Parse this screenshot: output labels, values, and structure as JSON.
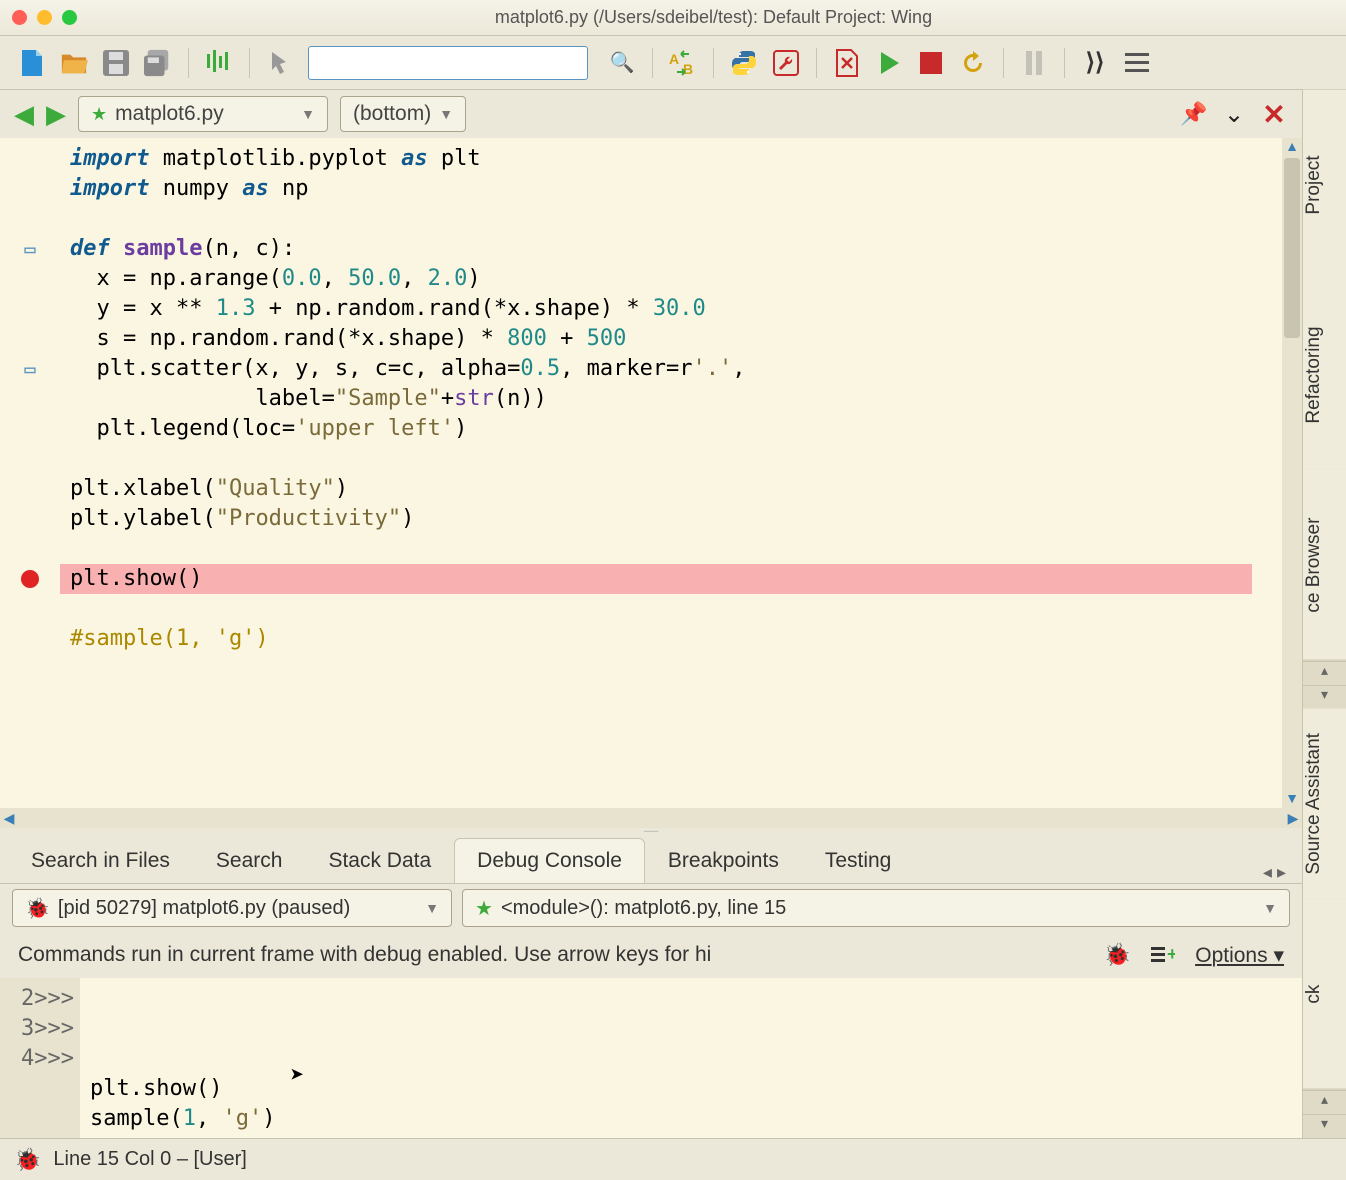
{
  "window": {
    "title": "matplot6.py (/Users/sdeibel/test): Default Project: Wing"
  },
  "toolbar": {
    "search_placeholder": ""
  },
  "filenav": {
    "filename": "matplot6.py",
    "scope": "(bottom)"
  },
  "code_lines": [
    {
      "type": "plain",
      "html": "<span class='kw'>import</span> matplotlib.pyplot <span class='kw'>as</span> plt"
    },
    {
      "type": "plain",
      "html": "<span class='kw'>import</span> numpy <span class='kw'>as</span> np"
    },
    {
      "type": "plain",
      "html": ""
    },
    {
      "type": "fold",
      "html": "<span class='kw'>def</span> <span class='fn'>sample</span>(n, c):"
    },
    {
      "type": "plain",
      "html": "  x = np.arange(<span class='num'>0.0</span>, <span class='num'>50.0</span>, <span class='num'>2.0</span>)"
    },
    {
      "type": "plain",
      "html": "  y = x ** <span class='num'>1.3</span> + np.random.rand(*x.shape) * <span class='num'>30.0</span>"
    },
    {
      "type": "plain",
      "html": "  s = np.random.rand(*x.shape) * <span class='num'>800</span> + <span class='num'>500</span>"
    },
    {
      "type": "fold",
      "html": "  plt.scatter(x, y, s, c=c, alpha=<span class='num'>0.5</span>, marker=r<span class='str'>'.'</span>,"
    },
    {
      "type": "plain",
      "html": "              label=<span class='str'>\"Sample\"</span>+<span class='builtin'>str</span>(n))"
    },
    {
      "type": "plain",
      "html": "  plt.legend(loc=<span class='str'>'upper left'</span>)"
    },
    {
      "type": "plain",
      "html": ""
    },
    {
      "type": "plain",
      "html": "plt.xlabel(<span class='str'>\"Quality\"</span>)"
    },
    {
      "type": "plain",
      "html": "plt.ylabel(<span class='str'>\"Productivity\"</span>)"
    },
    {
      "type": "plain",
      "html": ""
    },
    {
      "type": "bp",
      "html": "plt.show()"
    },
    {
      "type": "plain",
      "html": ""
    },
    {
      "type": "plain",
      "html": "<span class='cmt'>#sample(1, 'g')</span>"
    }
  ],
  "bottom_tabs": [
    "Search in Files",
    "Search",
    "Stack Data",
    "Debug Console",
    "Breakpoints",
    "Testing"
  ],
  "bottom_active": "Debug Console",
  "debug": {
    "process": "[pid 50279] matplot6.py (paused)",
    "frame": "<module>(): matplot6.py, line 15",
    "info_msg": "Commands run in current frame with debug enabled.  Use arrow keys for hi",
    "options_label": "Options"
  },
  "console_lines": [
    {
      "n": "2>>>",
      "html": "plt.show()"
    },
    {
      "n": "3>>>",
      "html": "sample(<span class='num'>1</span>, <span class='str'>'g'</span>)"
    },
    {
      "n": "4>>>",
      "html": ""
    }
  ],
  "side_tabs": [
    "Project",
    "Refactoring",
    "ce Browser",
    "Source Assistant",
    "ck"
  ],
  "status": {
    "text": "Line 15 Col 0 – [User]"
  }
}
